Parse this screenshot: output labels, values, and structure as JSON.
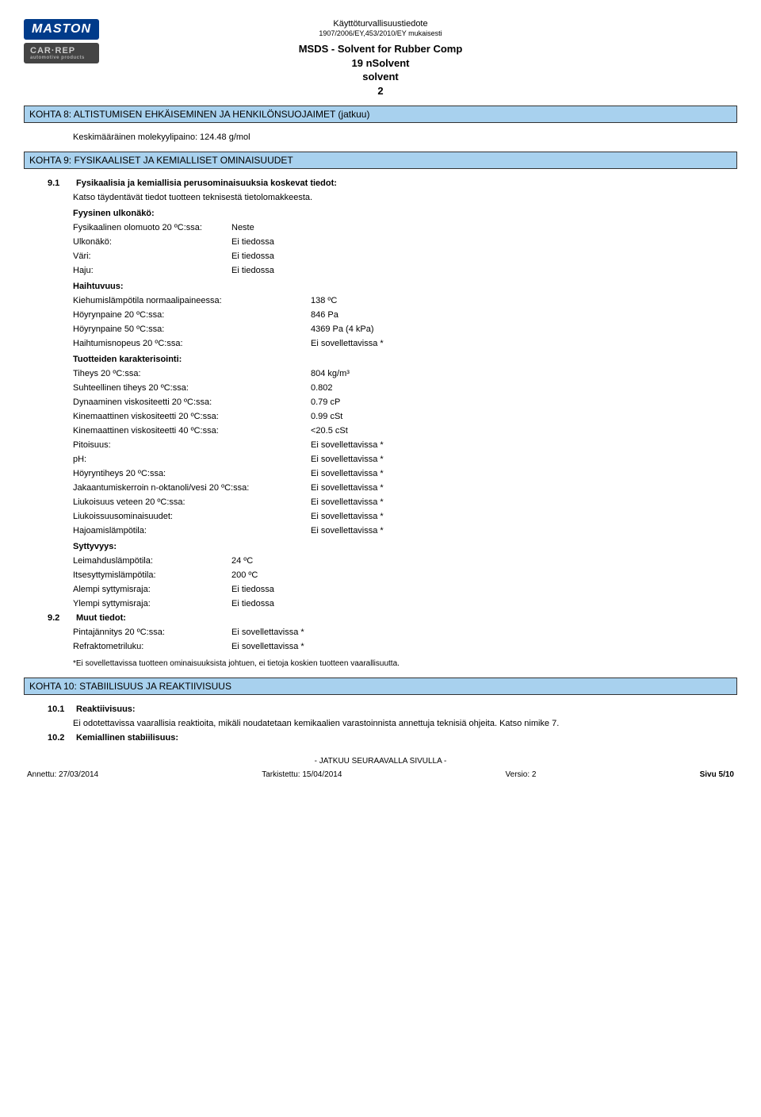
{
  "header": {
    "logo1": "MASTON",
    "logo2": "CAR·REP",
    "logo2_sub": "automotive products",
    "top": "Käyttöturvallisuustiedote",
    "reg": "1907/2006/EY,453/2010/EY mukaisesti",
    "title_l1": "MSDS - Solvent for Rubber Comp",
    "title_l2": "19 nSolvent",
    "title_l3": "solvent",
    "title_l4": "2"
  },
  "section8": {
    "title": "KOHTA 8: ALTISTUMISEN EHKÄISEMINEN JA HENKILÖNSUOJAIMET (jatkuu)",
    "mw_label": "Keskimääräinen molekyylipaino:",
    "mw_value": "124.48 g/mol"
  },
  "section9": {
    "title": "KOHTA 9: FYSIKAALISET JA KEMIALLISET OMINAISUUDET",
    "n1": "9.1",
    "h1": "Fysikaalisia ja kemiallisia perusominaisuuksia koskevat tiedot:",
    "h1_sub": "Katso täydentävät tiedot tuotteen teknisestä tietolomakkeesta.",
    "appearance_head": "Fyysinen ulkonäkö:",
    "phys_state_l": "Fysikaalinen olomuoto 20 ºC:ssa:",
    "phys_state_v": "Neste",
    "look_l": "Ulkonäkö:",
    "look_v": "Ei tiedossa",
    "color_l": "Väri:",
    "color_v": "Ei tiedossa",
    "odor_l": "Haju:",
    "odor_v": "Ei tiedossa",
    "volat_head": "Haihtuvuus:",
    "bp_l": "Kiehumislämpötila normaalipaineessa:",
    "bp_v": "138 ºC",
    "vp20_l": "Höyrynpaine 20 ºC:ssa:",
    "vp20_v": "846 Pa",
    "vp50_l": "Höyrynpaine 50 ºC:ssa:",
    "vp50_v": "4369 Pa  (4 kPa)",
    "evap_l": "Haihtumisnopeus 20 ºC:ssa:",
    "evap_v": "Ei sovellettavissa *",
    "char_head": "Tuotteiden karakterisointi:",
    "dens_l": "Tiheys 20 ºC:ssa:",
    "dens_v": "804 kg/m³",
    "reldens_l": "Suhteellinen tiheys 20 ºC:ssa:",
    "reldens_v": "0.802",
    "dynvisc_l": "Dynaaminen viskositeetti 20 ºC:ssa:",
    "dynvisc_v": "0.79 cP",
    "kinvisc20_l": "Kinemaattinen viskositeetti 20 ºC:ssa:",
    "kinvisc20_v": "0.99 cSt",
    "kinvisc40_l": "Kinemaattinen viskositeetti 40 ºC:ssa:",
    "kinvisc40_v": "<20.5 cSt",
    "conc_l": "Pitoisuus:",
    "conc_v": "Ei sovellettavissa *",
    "ph_l": "pH:",
    "ph_v": "Ei sovellettavissa *",
    "vapdens_l": "Höyryntiheys 20 ºC:ssa:",
    "vapdens_v": "Ei sovellettavissa *",
    "part_l": "Jakaantumiskerroin n-oktanoli/vesi 20 ºC:ssa:",
    "part_v": "Ei sovellettavissa *",
    "solw_l": "Liukoisuus veteen 20 ºC:ssa:",
    "solw_v": "Ei sovellettavissa *",
    "solp_l": "Liukoissuusominaisuudet:",
    "solp_v": "Ei sovellettavissa *",
    "decomp_l": "Hajoamislämpötila:",
    "decomp_v": "Ei sovellettavissa *",
    "flam_head": "Syttyvyys:",
    "flash_l": "Leimahduslämpötila:",
    "flash_v": "24 ºC",
    "auto_l": "Itsesyttymislämpötila:",
    "auto_v": "200 ºC",
    "lfl_l": "Alempi syttymisraja:",
    "lfl_v": "Ei tiedossa",
    "ufl_l": "Ylempi syttymisraja:",
    "ufl_v": "Ei tiedossa",
    "n2": "9.2",
    "h2": "Muut tiedot:",
    "surf_l": "Pintajännitys 20 ºC:ssa:",
    "surf_v": "Ei sovellettavissa *",
    "refr_l": "Refraktometriluku:",
    "refr_v": "Ei sovellettavissa *",
    "note": "*Ei sovellettavissa tuotteen ominaisuuksista johtuen, ei tietoja koskien tuotteen vaarallisuutta."
  },
  "section10": {
    "title": "KOHTA 10: STABIILISUUS JA REAKTIIVISUUS",
    "n1": "10.1",
    "h1": "Reaktiivisuus:",
    "t1": "Ei odotettavissa vaarallisia reaktioita, mikäli noudatetaan kemikaalien varastoinnista annettuja teknisiä ohjeita. Katso nimike 7.",
    "n2": "10.2",
    "h2": "Kemiallinen stabiilisuus:"
  },
  "footer": {
    "cont": "- JATKUU SEURAAVALLA SIVULLA -",
    "issued_l": "Annettu: 27/03/2014",
    "rev_l": "Tarkistettu: 15/04/2014",
    "ver_l": "Versio: 2",
    "page_l": "Sivu 5/10"
  }
}
